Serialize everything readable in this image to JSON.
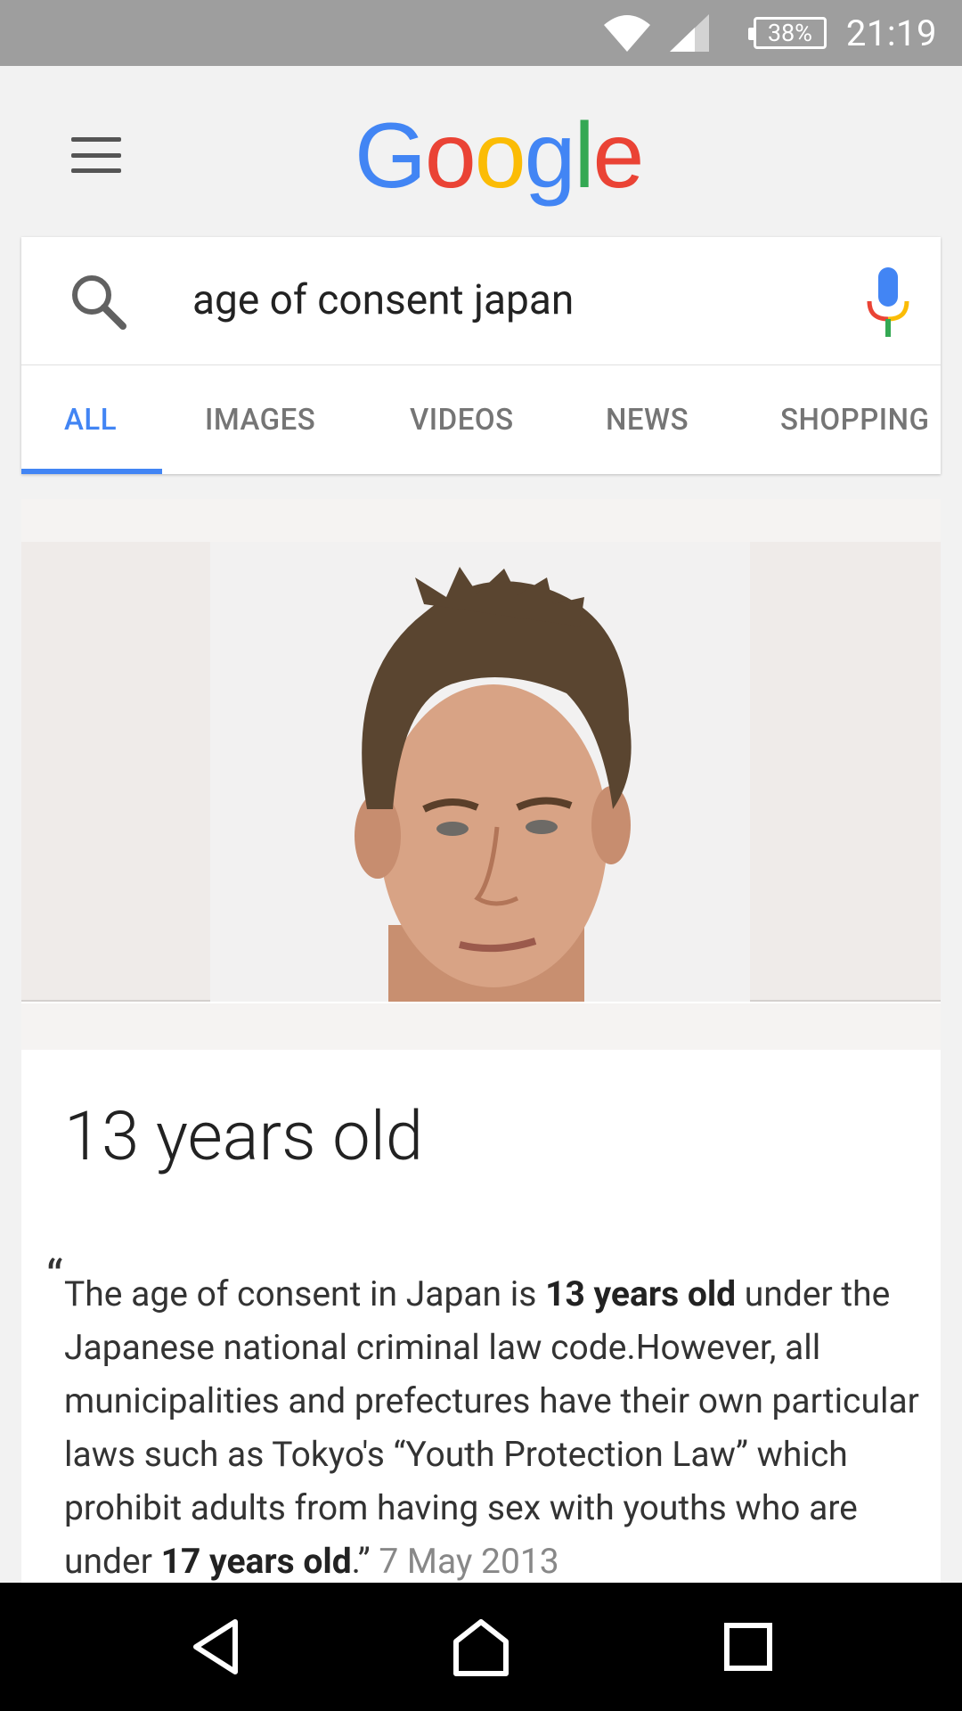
{
  "status_bar": {
    "battery": "38%",
    "time": "21:19"
  },
  "header": {
    "logo": "Google",
    "logo_letters": [
      "G",
      "o",
      "o",
      "g",
      "l",
      "e"
    ],
    "colors": {
      "blue": "#4285f4",
      "red": "#ea4335",
      "yellow": "#fbbc05",
      "green": "#34a853"
    }
  },
  "search": {
    "query": "age of consent japan"
  },
  "tabs": [
    {
      "label": "ALL",
      "active": true
    },
    {
      "label": "IMAGES",
      "active": false
    },
    {
      "label": "VIDEOS",
      "active": false
    },
    {
      "label": "NEWS",
      "active": false
    },
    {
      "label": "SHOPPING",
      "active": false
    }
  ],
  "result": {
    "answer": "13 years old",
    "snippet": {
      "part1": "The age of consent in Japan is ",
      "bold1": "13 years old",
      "part2": " under the Japanese national criminal law code.However, all municipalities and prefectures have their own particular laws such as Tokyo's “Youth Protection Law” which prohibit adults from having sex with youths who are under ",
      "bold2": "17 years old",
      "part3": ".",
      "date": "7 May 2013"
    }
  },
  "icons": [
    "menu-icon",
    "search-icon",
    "mic-icon",
    "wifi-icon",
    "signal-icon",
    "back-icon",
    "home-icon",
    "recents-icon"
  ]
}
